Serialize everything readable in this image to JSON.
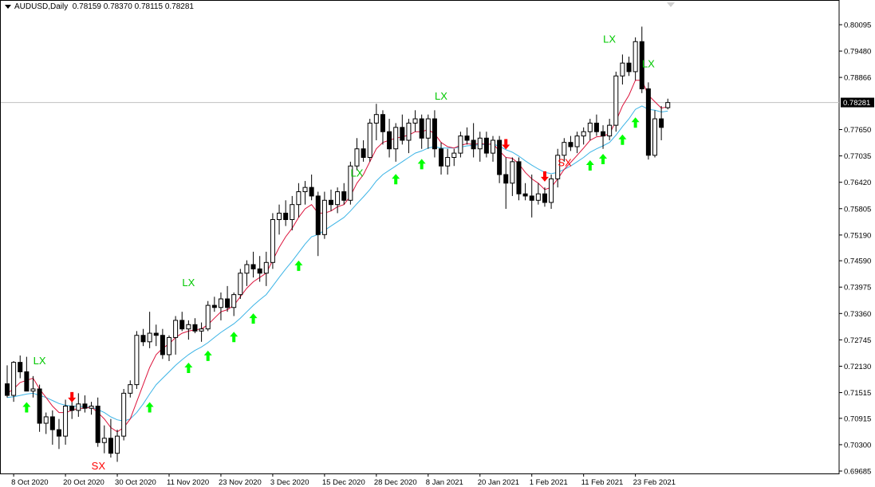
{
  "header": {
    "symbol": "AUDUSD,Daily",
    "ohlc": "0.78159 0.78370 0.78115 0.78281"
  },
  "current_price_label": "0.78281",
  "colors": {
    "bull_fill": "#ffffff",
    "bear_fill": "#000000",
    "candle_outline": "#000000",
    "fast_ma": "#dc143c",
    "slow_ma": "#3cb4e6",
    "buy_arrow": "#00ff00",
    "sell_arrow": "#ff0000",
    "lx_text": "#00c800",
    "sx_text": "#ff0000",
    "price_line": "#c0c0c0",
    "grid_bg": "#ffffff"
  },
  "chart_data": {
    "type": "candlestick",
    "symbol": "AUDUSD",
    "timeframe": "Daily",
    "y_ticks": [
      "0.80095",
      "0.79480",
      "0.78866",
      "0.78281",
      "0.77650",
      "0.77035",
      "0.76420",
      "0.75805",
      "0.75190",
      "0.74590",
      "0.73975",
      "0.73360",
      "0.72745",
      "0.72130",
      "0.71515",
      "0.70915",
      "0.70300",
      "0.69685"
    ],
    "ylim": [
      0.69685,
      0.803
    ],
    "x_ticks": [
      {
        "label": "8 Oct 2020",
        "i": 1
      },
      {
        "label": "20 Oct 2020",
        "i": 9
      },
      {
        "label": "30 Oct 2020",
        "i": 17
      },
      {
        "label": "11 Nov 2020",
        "i": 25
      },
      {
        "label": "23 Nov 2020",
        "i": 33
      },
      {
        "label": "3 Dec 2020",
        "i": 41
      },
      {
        "label": "15 Dec 2020",
        "i": 49
      },
      {
        "label": "28 Dec 2020",
        "i": 57
      },
      {
        "label": "8 Jan 2021",
        "i": 65
      },
      {
        "label": "20 Jan 2021",
        "i": 73
      },
      {
        "label": "1 Feb 2021",
        "i": 81
      },
      {
        "label": "11 Feb 2021",
        "i": 89
      },
      {
        "label": "23 Feb 2021",
        "i": 97
      }
    ],
    "candles": [
      [
        0.7172,
        0.7215,
        0.714,
        0.7145
      ],
      [
        0.7145,
        0.7225,
        0.713,
        0.7222
      ],
      [
        0.7222,
        0.7238,
        0.7185,
        0.72
      ],
      [
        0.72,
        0.7235,
        0.718,
        0.7155
      ],
      [
        0.7155,
        0.719,
        0.714,
        0.716
      ],
      [
        0.716,
        0.717,
        0.706,
        0.708
      ],
      [
        0.708,
        0.7105,
        0.7055,
        0.7095
      ],
      [
        0.7095,
        0.711,
        0.703,
        0.7065
      ],
      [
        0.7065,
        0.709,
        0.702,
        0.705
      ],
      [
        0.705,
        0.7135,
        0.703,
        0.712
      ],
      [
        0.712,
        0.7145,
        0.709,
        0.711
      ],
      [
        0.711,
        0.715,
        0.7095,
        0.7125
      ],
      [
        0.7125,
        0.7145,
        0.7105,
        0.7115
      ],
      [
        0.7115,
        0.713,
        0.71,
        0.712
      ],
      [
        0.712,
        0.714,
        0.7025,
        0.7035
      ],
      [
        0.7035,
        0.7075,
        0.701,
        0.7045
      ],
      [
        0.7045,
        0.709,
        0.7,
        0.701
      ],
      [
        0.701,
        0.7065,
        0.699,
        0.705
      ],
      [
        0.705,
        0.716,
        0.704,
        0.715
      ],
      [
        0.715,
        0.718,
        0.714,
        0.717
      ],
      [
        0.717,
        0.7295,
        0.716,
        0.7285
      ],
      [
        0.7285,
        0.73,
        0.726,
        0.727
      ],
      [
        0.727,
        0.734,
        0.7255,
        0.729
      ],
      [
        0.729,
        0.731,
        0.726,
        0.7285
      ],
      [
        0.7285,
        0.73,
        0.723,
        0.724
      ],
      [
        0.724,
        0.7285,
        0.7225,
        0.728
      ],
      [
        0.728,
        0.733,
        0.724,
        0.732
      ],
      [
        0.732,
        0.734,
        0.7295,
        0.73
      ],
      [
        0.73,
        0.732,
        0.7275,
        0.731
      ],
      [
        0.731,
        0.7325,
        0.729,
        0.7295
      ],
      [
        0.7295,
        0.7315,
        0.727,
        0.73
      ],
      [
        0.73,
        0.7365,
        0.7295,
        0.7355
      ],
      [
        0.7355,
        0.7375,
        0.734,
        0.735
      ],
      [
        0.735,
        0.7385,
        0.732,
        0.737
      ],
      [
        0.737,
        0.74,
        0.734,
        0.735
      ],
      [
        0.735,
        0.7385,
        0.733,
        0.738
      ],
      [
        0.738,
        0.744,
        0.737,
        0.743
      ],
      [
        0.743,
        0.746,
        0.74,
        0.745
      ],
      [
        0.745,
        0.748,
        0.742,
        0.744
      ],
      [
        0.744,
        0.747,
        0.741,
        0.743
      ],
      [
        0.743,
        0.748,
        0.74,
        0.7455
      ],
      [
        0.7455,
        0.757,
        0.744,
        0.7555
      ],
      [
        0.7555,
        0.759,
        0.752,
        0.757
      ],
      [
        0.757,
        0.76,
        0.754,
        0.7555
      ],
      [
        0.7555,
        0.761,
        0.753,
        0.759
      ],
      [
        0.759,
        0.764,
        0.756,
        0.762
      ],
      [
        0.762,
        0.7645,
        0.759,
        0.763
      ],
      [
        0.763,
        0.766,
        0.76,
        0.761
      ],
      [
        0.761,
        0.762,
        0.747,
        0.752
      ],
      [
        0.752,
        0.762,
        0.751,
        0.76
      ],
      [
        0.76,
        0.7625,
        0.7575,
        0.759
      ],
      [
        0.759,
        0.763,
        0.757,
        0.762
      ],
      [
        0.762,
        0.764,
        0.759,
        0.76
      ],
      [
        0.76,
        0.769,
        0.759,
        0.768
      ],
      [
        0.768,
        0.7745,
        0.767,
        0.772
      ],
      [
        0.772,
        0.774,
        0.769,
        0.77
      ],
      [
        0.77,
        0.779,
        0.769,
        0.778
      ],
      [
        0.778,
        0.7825,
        0.774,
        0.78
      ],
      [
        0.78,
        0.781,
        0.773,
        0.776
      ],
      [
        0.776,
        0.779,
        0.77,
        0.772
      ],
      [
        0.772,
        0.778,
        0.769,
        0.777
      ],
      [
        0.777,
        0.78,
        0.773,
        0.774
      ],
      [
        0.774,
        0.779,
        0.771,
        0.778
      ],
      [
        0.778,
        0.781,
        0.776,
        0.779
      ],
      [
        0.779,
        0.78,
        0.772,
        0.7745
      ],
      [
        0.7745,
        0.78,
        0.772,
        0.779
      ],
      [
        0.779,
        0.781,
        0.77,
        0.772
      ],
      [
        0.772,
        0.7735,
        0.766,
        0.768
      ],
      [
        0.768,
        0.772,
        0.766,
        0.77
      ],
      [
        0.77,
        0.772,
        0.768,
        0.771
      ],
      [
        0.771,
        0.776,
        0.77,
        0.775
      ],
      [
        0.775,
        0.777,
        0.773,
        0.774
      ],
      [
        0.774,
        0.778,
        0.77,
        0.772
      ],
      [
        0.772,
        0.776,
        0.769,
        0.7745
      ],
      [
        0.7745,
        0.776,
        0.77,
        0.771
      ],
      [
        0.771,
        0.775,
        0.769,
        0.774
      ],
      [
        0.774,
        0.775,
        0.764,
        0.766
      ],
      [
        0.766,
        0.77,
        0.758,
        0.764
      ],
      [
        0.764,
        0.77,
        0.761,
        0.769
      ],
      [
        0.769,
        0.77,
        0.76,
        0.7615
      ],
      [
        0.7615,
        0.764,
        0.76,
        0.761
      ],
      [
        0.761,
        0.766,
        0.756,
        0.76
      ],
      [
        0.76,
        0.764,
        0.759,
        0.7615
      ],
      [
        0.7615,
        0.763,
        0.7585,
        0.7595
      ],
      [
        0.7595,
        0.766,
        0.758,
        0.765
      ],
      [
        0.765,
        0.772,
        0.763,
        0.7705
      ],
      [
        0.7705,
        0.7745,
        0.769,
        0.7735
      ],
      [
        0.7735,
        0.775,
        0.7715,
        0.7725
      ],
      [
        0.7725,
        0.776,
        0.771,
        0.775
      ],
      [
        0.775,
        0.777,
        0.773,
        0.776
      ],
      [
        0.776,
        0.779,
        0.774,
        0.778
      ],
      [
        0.778,
        0.78,
        0.775,
        0.776
      ],
      [
        0.776,
        0.7775,
        0.772,
        0.775
      ],
      [
        0.775,
        0.779,
        0.774,
        0.7775
      ],
      [
        0.7775,
        0.79,
        0.776,
        0.789
      ],
      [
        0.789,
        0.794,
        0.787,
        0.792
      ],
      [
        0.792,
        0.7935,
        0.789,
        0.79
      ],
      [
        0.79,
        0.798,
        0.788,
        0.797
      ],
      [
        0.797,
        0.8005,
        0.785,
        0.786
      ],
      [
        0.786,
        0.7875,
        0.7695,
        0.7705
      ],
      [
        0.7705,
        0.781,
        0.77,
        0.779
      ],
      [
        0.779,
        0.782,
        0.774,
        0.777
      ],
      [
        0.7816,
        0.7837,
        0.7812,
        0.7828
      ]
    ],
    "fast_ma": [
      0.715,
      0.716,
      0.7175,
      0.718,
      0.7185,
      0.716,
      0.714,
      0.712,
      0.7105,
      0.7105,
      0.711,
      0.7115,
      0.7115,
      0.7118,
      0.7105,
      0.709,
      0.707,
      0.706,
      0.707,
      0.709,
      0.713,
      0.717,
      0.721,
      0.724,
      0.7255,
      0.7265,
      0.728,
      0.729,
      0.7295,
      0.7298,
      0.73,
      0.731,
      0.7325,
      0.734,
      0.7345,
      0.7355,
      0.7375,
      0.7395,
      0.741,
      0.742,
      0.743,
      0.746,
      0.749,
      0.7515,
      0.7535,
      0.756,
      0.758,
      0.759,
      0.757,
      0.757,
      0.7575,
      0.7585,
      0.759,
      0.761,
      0.764,
      0.766,
      0.769,
      0.772,
      0.7735,
      0.774,
      0.7745,
      0.7748,
      0.7752,
      0.776,
      0.776,
      0.7765,
      0.7755,
      0.7735,
      0.7725,
      0.7722,
      0.7728,
      0.7732,
      0.773,
      0.7733,
      0.773,
      0.7732,
      0.7715,
      0.77,
      0.7698,
      0.7685,
      0.7665,
      0.765,
      0.764,
      0.7625,
      0.763,
      0.765,
      0.7672,
      0.7688,
      0.7705,
      0.7722,
      0.774,
      0.7748,
      0.775,
      0.7755,
      0.7785,
      0.782,
      0.7845,
      0.788,
      0.788,
      0.7845,
      0.783,
      0.7815,
      0.7818
    ],
    "slow_ma": [
      0.714,
      0.7142,
      0.7145,
      0.7148,
      0.715,
      0.7145,
      0.714,
      0.7133,
      0.7126,
      0.7122,
      0.712,
      0.712,
      0.7118,
      0.7117,
      0.7112,
      0.7105,
      0.7095,
      0.7088,
      0.7085,
      0.709,
      0.7105,
      0.7125,
      0.7148,
      0.717,
      0.7185,
      0.72,
      0.7215,
      0.7228,
      0.724,
      0.725,
      0.7258,
      0.7268,
      0.728,
      0.7292,
      0.7302,
      0.7312,
      0.7325,
      0.734,
      0.7355,
      0.7368,
      0.738,
      0.74,
      0.742,
      0.744,
      0.7458,
      0.7478,
      0.7498,
      0.7515,
      0.752,
      0.753,
      0.754,
      0.755,
      0.756,
      0.7575,
      0.7592,
      0.7608,
      0.7625,
      0.7645,
      0.766,
      0.767,
      0.768,
      0.769,
      0.77,
      0.771,
      0.7715,
      0.7722,
      0.7725,
      0.7722,
      0.7722,
      0.7722,
      0.7724,
      0.7727,
      0.7728,
      0.773,
      0.773,
      0.7731,
      0.7726,
      0.7718,
      0.7712,
      0.7703,
      0.7692,
      0.7682,
      0.7673,
      0.7665,
      0.7662,
      0.7665,
      0.7672,
      0.768,
      0.769,
      0.77,
      0.7712,
      0.772,
      0.7727,
      0.7735,
      0.7752,
      0.7772,
      0.779,
      0.7812,
      0.782,
      0.7812,
      0.781,
      0.7806,
      0.7808
    ],
    "buy_arrows": [
      3,
      22,
      28,
      31,
      35,
      38,
      45,
      60,
      64,
      90,
      92,
      95,
      97
    ],
    "sell_arrows": [
      10,
      77,
      83
    ],
    "labels": [
      {
        "text": "LX",
        "i": 5,
        "price": 0.7218
      },
      {
        "text": "LX",
        "i": 28,
        "price": 0.74
      },
      {
        "text": "LX",
        "i": 54,
        "price": 0.7655
      },
      {
        "text": "LX",
        "i": 67,
        "price": 0.7835
      },
      {
        "text": "LX",
        "i": 93,
        "price": 0.7968
      },
      {
        "text": "LX",
        "i": 99,
        "price": 0.791
      },
      {
        "text": "SX",
        "i": 14,
        "price": 0.6972
      },
      {
        "text": "SX",
        "i": 86,
        "price": 0.768
      }
    ],
    "current_price": 0.78281
  }
}
